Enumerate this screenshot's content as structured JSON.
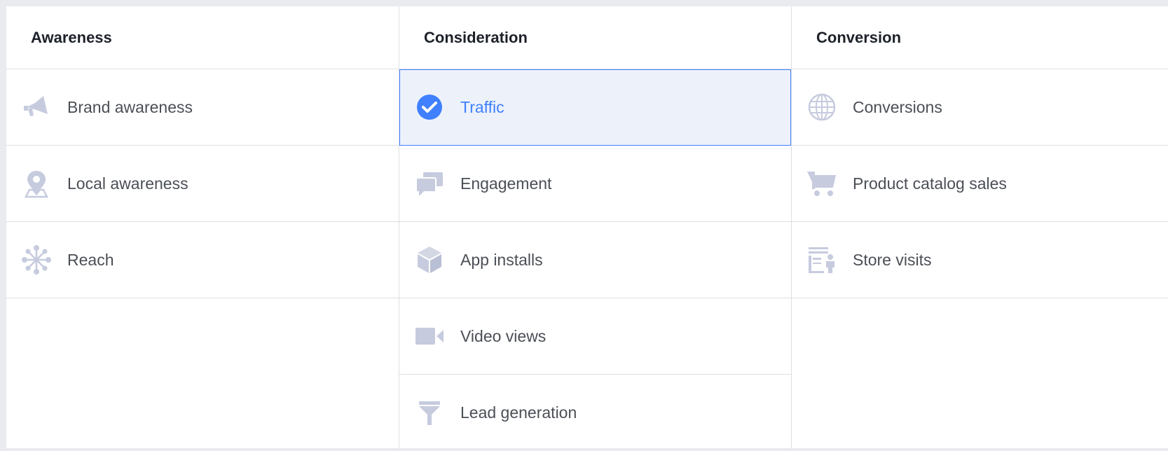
{
  "columns": [
    {
      "header": "Awareness",
      "items": [
        {
          "label": "Brand awareness",
          "icon": "megaphone-icon"
        },
        {
          "label": "Local awareness",
          "icon": "map-pin-icon"
        },
        {
          "label": "Reach",
          "icon": "network-icon"
        }
      ]
    },
    {
      "header": "Consideration",
      "items": [
        {
          "label": "Traffic",
          "icon": "check-circle-icon",
          "selected": true
        },
        {
          "label": "Engagement",
          "icon": "chat-bubbles-icon"
        },
        {
          "label": "App installs",
          "icon": "box-icon"
        },
        {
          "label": "Video views",
          "icon": "video-camera-icon"
        },
        {
          "label": "Lead generation",
          "icon": "funnel-icon"
        }
      ]
    },
    {
      "header": "Conversion",
      "items": [
        {
          "label": "Conversions",
          "icon": "globe-icon"
        },
        {
          "label": "Product catalog sales",
          "icon": "shopping-cart-icon"
        },
        {
          "label": "Store visits",
          "icon": "store-icon"
        }
      ]
    }
  ],
  "colors": {
    "accent": "#4080ff",
    "selected_bg": "#edf2fa",
    "icon_gray": "#c6cbde",
    "text": "#4b4f56",
    "header_text": "#1d2129"
  }
}
